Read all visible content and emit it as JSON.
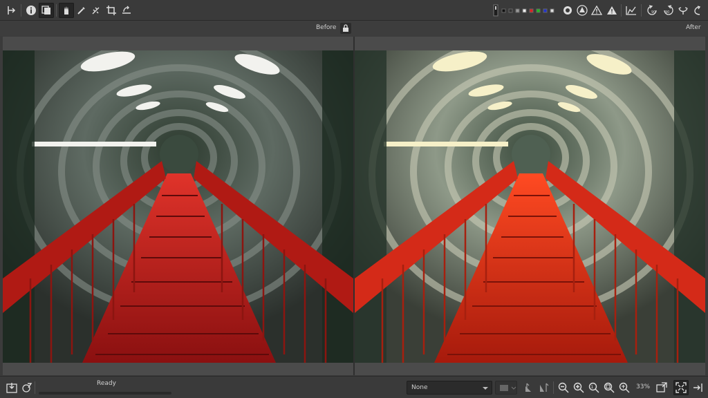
{
  "header": {
    "before_label": "Before",
    "after_label": "After"
  },
  "toolbar_left": [
    "split-view-icon",
    "info-icon",
    "before-after-icon",
    "hand-icon",
    "color-picker-icon",
    "straighten-icon",
    "crop-icon",
    "transform-icon"
  ],
  "toolbar_right": [
    "preview-mode-icon",
    "swatch-icons",
    "focus-mask-icon",
    "shadow-clip-icon",
    "warning-icon",
    "highlight-warning-icon",
    "histogram-icon",
    "rotate-left-icon",
    "rotate-right-icon",
    "flip-h-icon",
    "flip-v-icon"
  ],
  "statusbar": {
    "status": "Ready",
    "progress": 0,
    "profile_select": "None",
    "zoom": "33%"
  },
  "colors": {
    "accent": "#2a6ad8",
    "panel": "#3a3a3a",
    "canvas": "#4b4b4b"
  }
}
